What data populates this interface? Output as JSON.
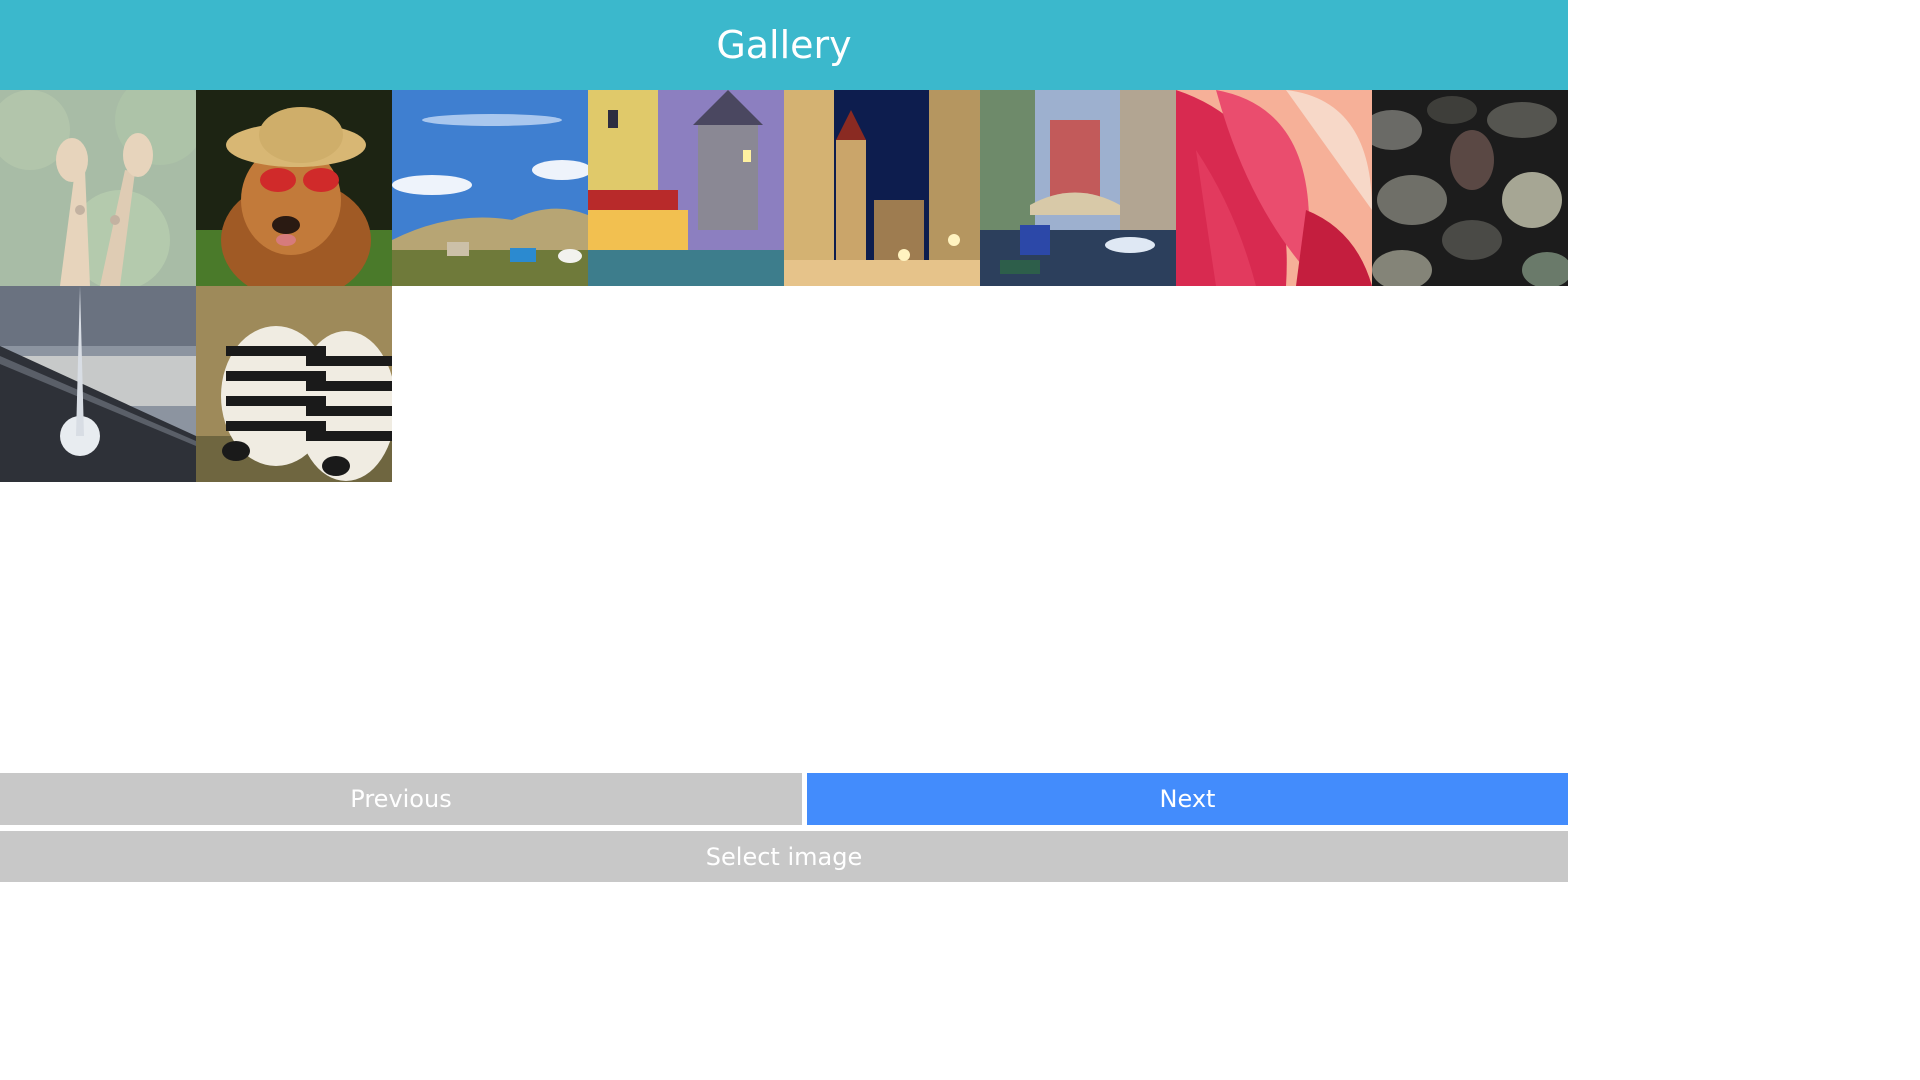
{
  "header": {
    "title": "Gallery"
  },
  "gallery": {
    "images": [
      {
        "name": "giraffes",
        "selected": true
      },
      {
        "name": "dog-with-sunglasses",
        "selected": false
      },
      {
        "name": "grassland-landscape",
        "selected": false
      },
      {
        "name": "canal-town-evening",
        "selected": false
      },
      {
        "name": "night-street",
        "selected": false
      },
      {
        "name": "venice-canal",
        "selected": false
      },
      {
        "name": "pink-flower-petals",
        "selected": false
      },
      {
        "name": "pebbles",
        "selected": false
      },
      {
        "name": "airplane-wing-sky",
        "selected": false
      },
      {
        "name": "zebras",
        "selected": false
      }
    ]
  },
  "controls": {
    "previous_label": "Previous",
    "next_label": "Next",
    "select_label": "Select image"
  },
  "colors": {
    "header": "#3bb8cc",
    "next_button": "#438cfc",
    "secondary_button": "#c8c8c8"
  }
}
